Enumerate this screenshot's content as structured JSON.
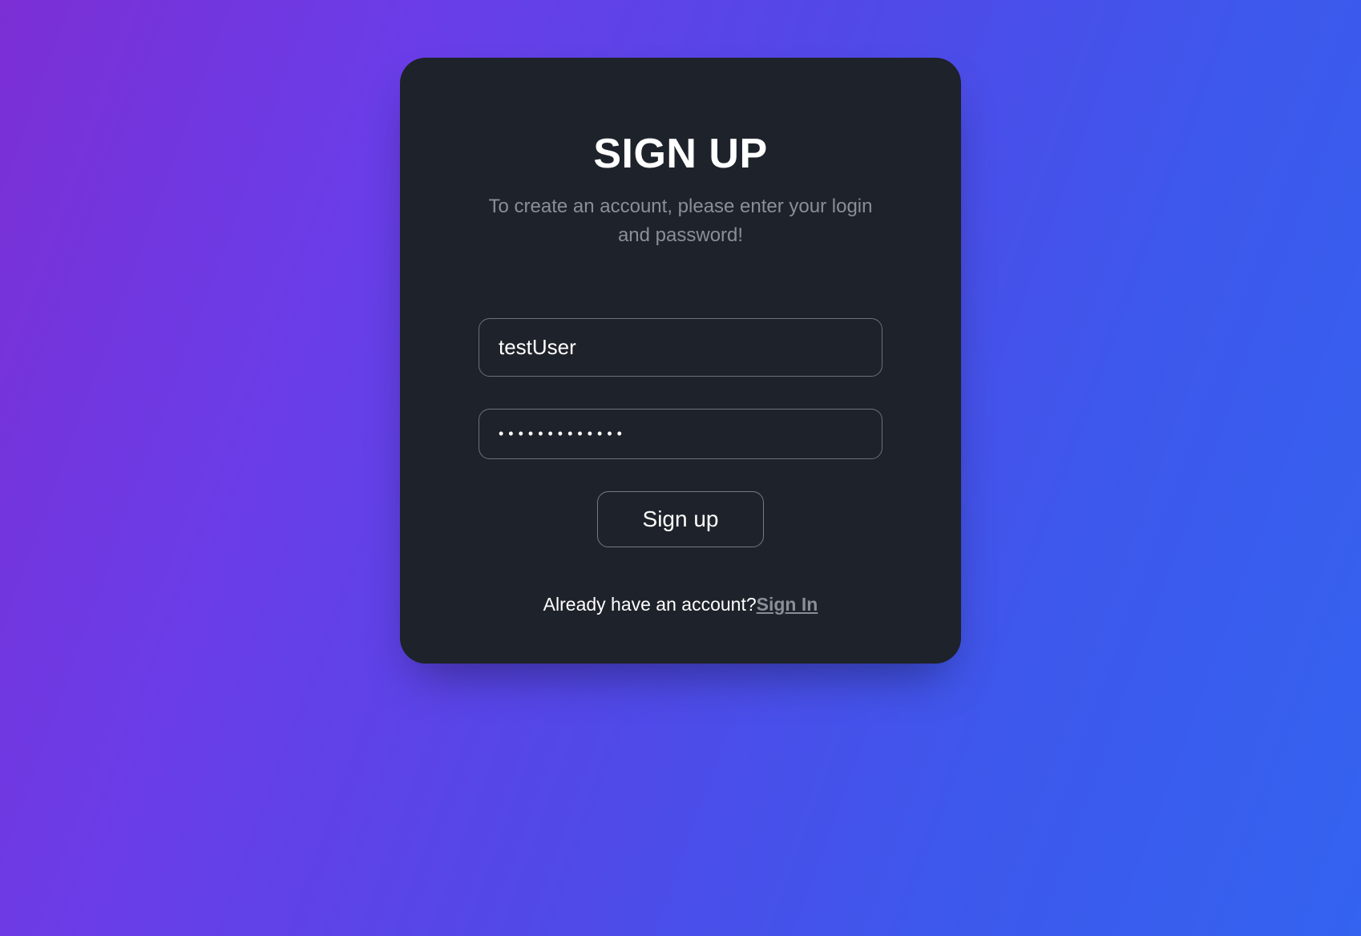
{
  "card": {
    "title": "SIGN UP",
    "subtitle": "To create an account, please enter your login and password!",
    "username": {
      "value": "testUser",
      "placeholder": ""
    },
    "password": {
      "value": "•••••••••••••",
      "placeholder": ""
    },
    "submit_label": "Sign up",
    "footer_text": "Already have an account?",
    "signin_link_label": "Sign In"
  }
}
